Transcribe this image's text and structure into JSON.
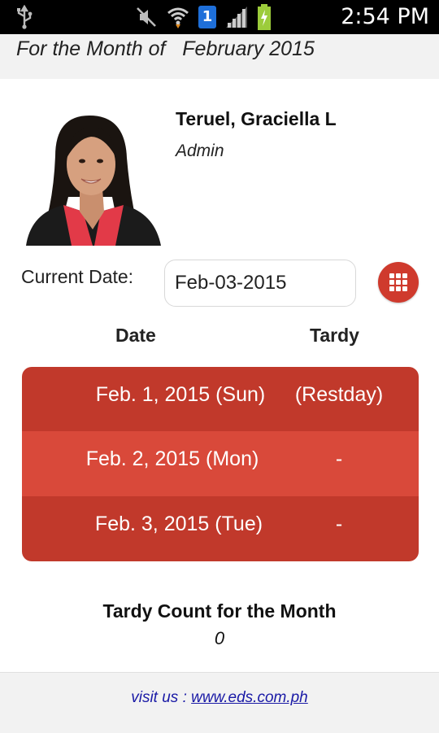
{
  "status_bar": {
    "time": "2:54 PM",
    "icons": [
      "usb-icon",
      "mute-icon",
      "wifi-icon",
      "sim-icon",
      "signal-icon",
      "battery-charging-icon"
    ],
    "sim_number": "1"
  },
  "header": {
    "month_label": "For the Month of",
    "month_value": "February 2015"
  },
  "profile": {
    "name": "Teruel, Graciella L",
    "role": "Admin"
  },
  "current_date": {
    "label": "Current Date:",
    "value": "Feb-03-2015"
  },
  "table": {
    "headers": {
      "date": "Date",
      "tardy": "Tardy"
    },
    "rows": [
      {
        "date": "Feb. 1, 2015 (Sun)",
        "tardy": "(Restday)"
      },
      {
        "date": "Feb. 2, 2015 (Mon)",
        "tardy": "-"
      },
      {
        "date": "Feb. 3, 2015 (Tue)",
        "tardy": "-"
      }
    ]
  },
  "tardy_count": {
    "label": "Tardy Count for the Month",
    "value": "0"
  },
  "footer": {
    "visit_label": "visit us :",
    "link_text": "www.eds.com.ph"
  },
  "colors": {
    "accent": "#cf3a2d",
    "row_dark": "#c1392b",
    "row_light": "#d9493a",
    "link": "#1a1aa6"
  }
}
